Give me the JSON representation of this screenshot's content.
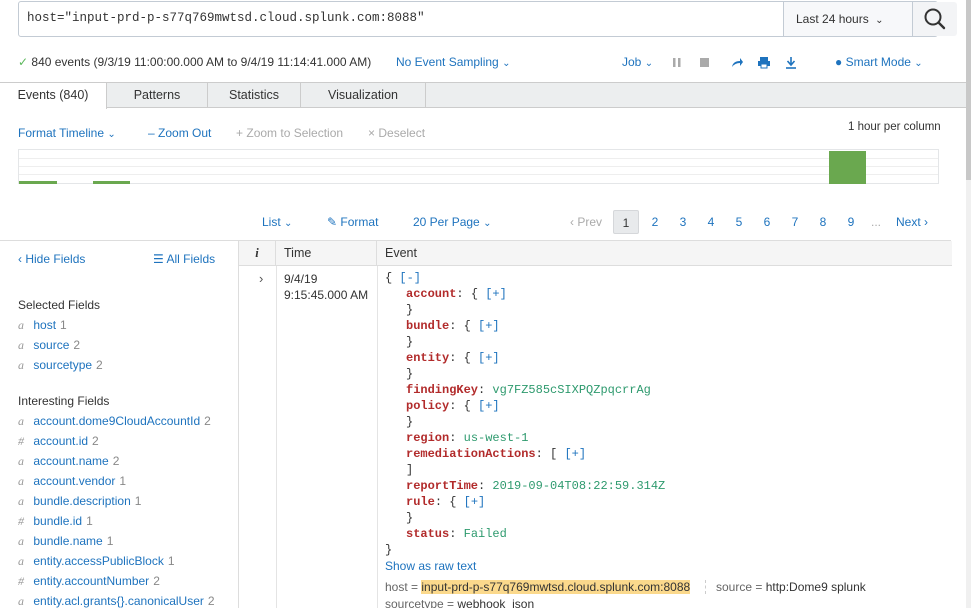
{
  "search": {
    "query": "host=\"input-prd-p-s77q769mwtsd.cloud.splunk.com:8088\"",
    "time_range": "Last 24 hours"
  },
  "status": {
    "summary": "840 events (9/3/19 11:00:00.000 AM to 9/4/19 11:14:41.000 AM)",
    "sampling": "No Event Sampling",
    "job": "Job",
    "mode": "Smart Mode"
  },
  "tabs": [
    "Events (840)",
    "Patterns",
    "Statistics",
    "Visualization"
  ],
  "timeline": {
    "format_label": "Format Timeline",
    "zoom_out": "Zoom Out",
    "zoom_selection": "Zoom to Selection",
    "deselect": "Deselect",
    "scale_label": "1 hour per column"
  },
  "results_toolbar": {
    "list": "List",
    "format": "Format",
    "per_page": "20 Per Page",
    "prev": "Prev",
    "pages": [
      "1",
      "2",
      "3",
      "4",
      "5",
      "6",
      "7",
      "8",
      "9"
    ],
    "ellipsis": "...",
    "next": "Next"
  },
  "sidebar": {
    "hide_fields": "Hide Fields",
    "all_fields": "All Fields",
    "selected_title": "Selected Fields",
    "selected": [
      {
        "type": "a",
        "name": "host",
        "count": "1"
      },
      {
        "type": "a",
        "name": "source",
        "count": "2"
      },
      {
        "type": "a",
        "name": "sourcetype",
        "count": "2"
      }
    ],
    "interesting_title": "Interesting Fields",
    "interesting": [
      {
        "type": "a",
        "name": "account.dome9CloudAccountId",
        "count": "2"
      },
      {
        "type": "#",
        "name": "account.id",
        "count": "2"
      },
      {
        "type": "a",
        "name": "account.name",
        "count": "2"
      },
      {
        "type": "a",
        "name": "account.vendor",
        "count": "1"
      },
      {
        "type": "a",
        "name": "bundle.description",
        "count": "1"
      },
      {
        "type": "#",
        "name": "bundle.id",
        "count": "1"
      },
      {
        "type": "a",
        "name": "bundle.name",
        "count": "1"
      },
      {
        "type": "a",
        "name": "entity.accessPublicBlock",
        "count": "1"
      },
      {
        "type": "#",
        "name": "entity.accountNumber",
        "count": "2"
      },
      {
        "type": "a",
        "name": "entity.acl.grants{}.canonicalUser",
        "count": "2"
      }
    ]
  },
  "table": {
    "col_i": "i",
    "col_time": "Time",
    "col_event": "Event"
  },
  "event": {
    "date": "9/4/19",
    "time": "9:15:45.000 AM",
    "lines": [
      {
        "indent": 0,
        "pre": "{ ",
        "tog": "[-]"
      },
      {
        "indent": 1,
        "key": "account",
        "pun": ": { ",
        "tog": "[+]"
      },
      {
        "indent": 1,
        "pun": "}"
      },
      {
        "indent": 1,
        "key": "bundle",
        "pun": ": { ",
        "tog": "[+]"
      },
      {
        "indent": 1,
        "pun": "}"
      },
      {
        "indent": 1,
        "key": "entity",
        "pun": ": { ",
        "tog": "[+]"
      },
      {
        "indent": 1,
        "pun": "}"
      },
      {
        "indent": 1,
        "key": "findingKey",
        "pun": ": ",
        "val": "vg7FZ585cSIXPQZpqcrrAg"
      },
      {
        "indent": 1,
        "key": "policy",
        "pun": ": { ",
        "tog": "[+]"
      },
      {
        "indent": 1,
        "pun": "}"
      },
      {
        "indent": 1,
        "key": "region",
        "pun": ": ",
        "val": "us-west-1"
      },
      {
        "indent": 1,
        "key": "remediationActions",
        "pun": ": [ ",
        "tog": "[+]"
      },
      {
        "indent": 1,
        "pun": "]"
      },
      {
        "indent": 1,
        "key": "reportTime",
        "pun": ": ",
        "val": "2019-09-04T08:22:59.314Z"
      },
      {
        "indent": 1,
        "key": "rule",
        "pun": ": { ",
        "tog": "[+]"
      },
      {
        "indent": 1,
        "pun": "}"
      },
      {
        "indent": 1,
        "key": "status",
        "pun": ": ",
        "val": "Failed"
      },
      {
        "indent": 0,
        "pun": "}"
      }
    ],
    "show_raw": "Show as raw text",
    "meta_host_label": "host =",
    "meta_host_value": "input-prd-p-s77q769mwtsd.cloud.splunk.com:8088",
    "meta_source_label": "source =",
    "meta_source_value": "http:Dome9 splunk",
    "meta_sourcetype_label": "sourcetype =",
    "meta_sourcetype_value": "webhook_json"
  },
  "colors": {
    "link": "#1e73be",
    "json_key": "#b22b2b",
    "json_value": "#2e9a6e",
    "timeline_bar": "#6aa84f",
    "highlight": "#fbd98c"
  }
}
